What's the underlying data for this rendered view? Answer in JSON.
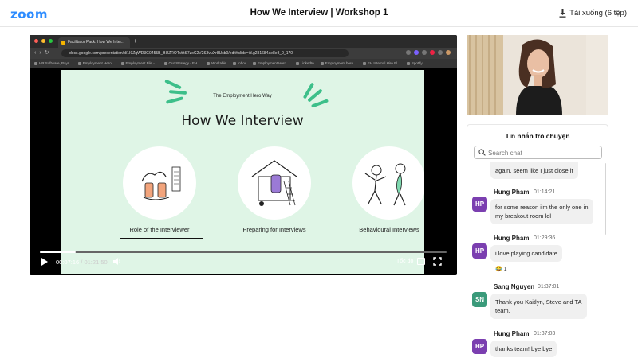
{
  "header": {
    "logo": "zoom",
    "title": "How We Interview | Workshop 1",
    "download_label": "Tải xuống (6 tệp)"
  },
  "browser": {
    "tab_title": "Facilitator Pack: How We Inter...",
    "url": "docs.google.com/presentation/d/1I9ZqWD3G0455B_BUZROTvbtS7zoC2V2S8vuXr8Usb0/edit#slide=id.g231684ae8e8_0_170",
    "bookmarks": [
      "HR Software, Payr...",
      "Employment Hero...",
      "Employment File -...",
      "Our Strategy - EH...",
      "Workable",
      "Inbox",
      "Employment Hero...",
      "LinkedIn",
      "Employment hero...",
      "EH Internal Hire Pl...",
      "Spotify"
    ]
  },
  "slide": {
    "subtitle": "The Employment Hero Way",
    "title": "How We Interview",
    "columns": [
      {
        "label": "Role of the Interviewer"
      },
      {
        "label": "Preparing for Interviews"
      },
      {
        "label": "Behavioural Interviews"
      }
    ],
    "accent_color": "#3dbf8a",
    "background_color": "#dff5e6"
  },
  "player": {
    "current_time": "00:07:16",
    "separator": " / ",
    "duration": "01:21:50",
    "progress_fraction": 0.089,
    "speed_label": "Tốc độ"
  },
  "chat": {
    "header": "Tin nhắn trò chuyện",
    "search_placeholder": "Search chat",
    "partial_message": "again, seem like I just close it",
    "messages": [
      {
        "initials": "HP",
        "sender": "Hung Pham",
        "time": "01:14:21",
        "lines": [
          "for some reason i'm the only one in",
          "my breakout room lol"
        ],
        "avatar_color": "#7b3fb0"
      },
      {
        "initials": "HP",
        "sender": "Hung Pham",
        "time": "01:29:36",
        "lines": [
          "i love playing candidate"
        ],
        "avatar_color": "#7b3fb0",
        "reaction": "😂 1"
      },
      {
        "initials": "SN",
        "sender": "Sang Nguyen",
        "time": "01:37:01",
        "lines": [
          "Thank you Kaitlyn, Steve and TA",
          "team."
        ],
        "avatar_color": "#3a9a7a"
      },
      {
        "initials": "HP",
        "sender": "Hung Pham",
        "time": "01:37:03",
        "lines": [
          "thanks team! bye bye"
        ],
        "avatar_color": "#7b3fb0"
      }
    ]
  },
  "colors": {
    "zoom_blue": "#2d8cff",
    "player_bg": "#000000"
  },
  "icons": [
    "download-icon",
    "play-icon",
    "volume-icon",
    "captions-icon",
    "fullscreen-icon",
    "search-icon"
  ]
}
